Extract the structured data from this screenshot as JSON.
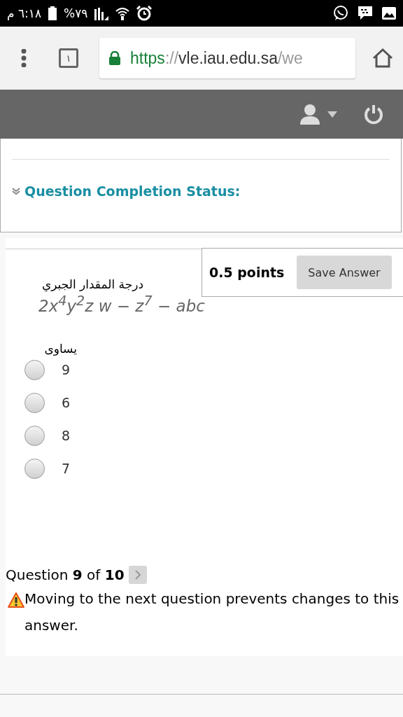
{
  "status_bar": {
    "time": "٦:١٨ م",
    "battery": "%٧٩"
  },
  "browser": {
    "tab_count": "١",
    "url": {
      "scheme": "https",
      "separator": "://",
      "host": "vle.iau.edu.sa",
      "path": "/we"
    }
  },
  "completion": {
    "title": "Question Completion Status:",
    "expanded": false
  },
  "question": {
    "points": "0.5 points",
    "save_button": "Save Answer",
    "prompt": "درجة المقدار الجبري",
    "expression": "2x$^{4}$y$^{2}$z w − z$^{7}$ − abc",
    "prompt_tail": "يساوى",
    "options": [
      {
        "label": "9",
        "selected": false
      },
      {
        "label": "6",
        "selected": false
      },
      {
        "label": "8",
        "selected": false
      },
      {
        "label": "7",
        "selected": false
      }
    ]
  },
  "navigation": {
    "question_prefix": "Question",
    "current": "9",
    "of": "of",
    "total": "10",
    "warning": "Moving to the next question prevents changes to this answer."
  }
}
